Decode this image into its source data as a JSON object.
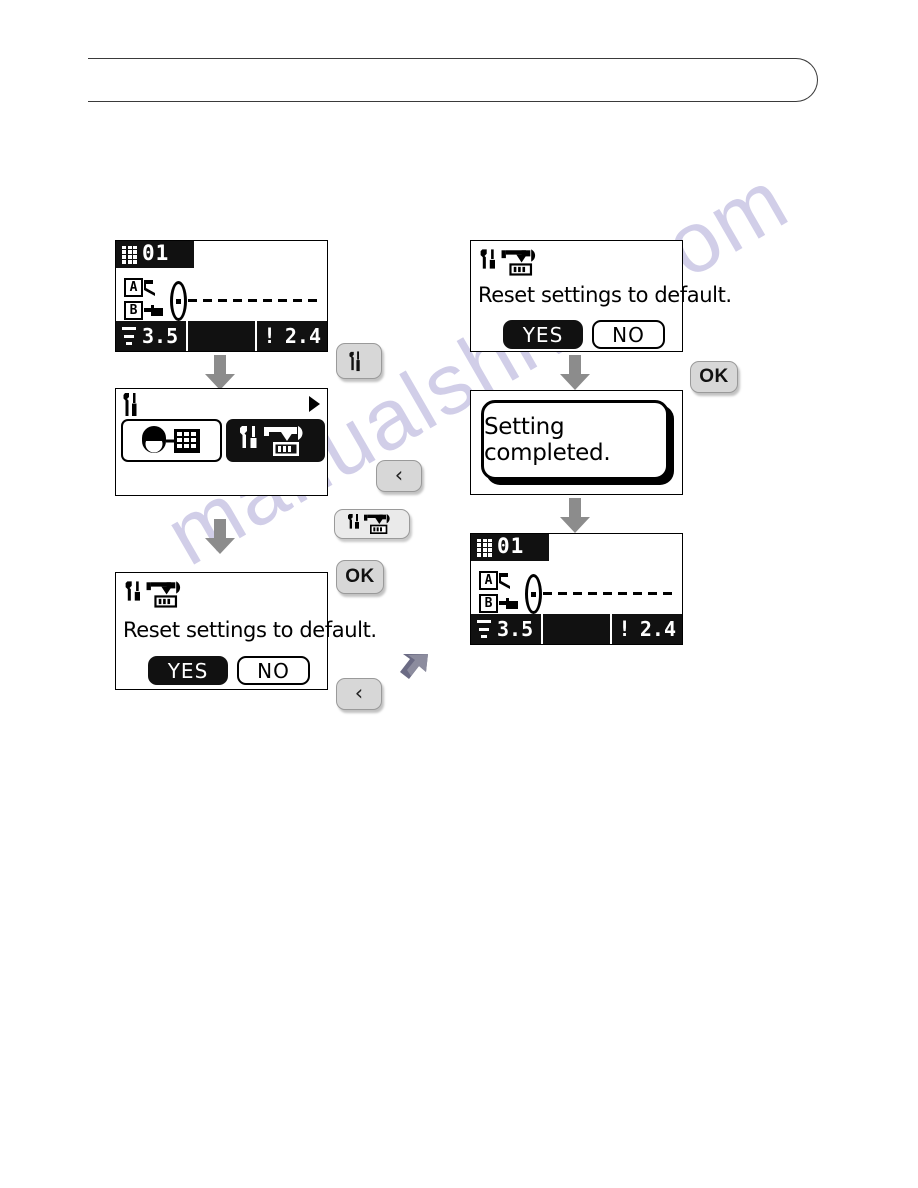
{
  "document": {
    "watermark": "manualshive.com"
  },
  "screens": {
    "stitch_initial": {
      "name": "stitch-select-screen",
      "pattern_number": "01",
      "pattern_grid_icon": "dot-matrix-icon",
      "foot_a_label": "A",
      "foot_b_label": "B",
      "width_icon": "stitch-width-icon",
      "width_value": "3.5",
      "length_icon": "stitch-length-icon",
      "length_value": "2.4",
      "middle_value": ""
    },
    "settings_menu": {
      "name": "settings-menu-screen",
      "header_icon": "tools-icon",
      "next_page_icon": "caret-right-icon",
      "option_machine_settings_icon": "face-grid-icon",
      "option_reset_icon": "tools-reset-icon",
      "selected_option": "reset"
    },
    "confirm_left": {
      "name": "reset-confirm-dialog",
      "icon": "tools-reset-icon",
      "message": "Reset settings to default.",
      "yes_label": "YES",
      "no_label": "NO",
      "selected": "YES"
    },
    "confirm_right": {
      "name": "reset-confirm-dialog",
      "icon": "tools-reset-icon",
      "message": "Reset settings to default.",
      "yes_label": "YES",
      "no_label": "NO",
      "selected": "YES"
    },
    "completed": {
      "name": "setting-completed-dialog",
      "message": "Setting completed."
    },
    "stitch_final": {
      "name": "stitch-select-screen",
      "pattern_number": "01",
      "pattern_grid_icon": "dot-matrix-icon",
      "foot_a_label": "A",
      "foot_b_label": "B",
      "width_icon": "stitch-width-icon",
      "width_value": "3.5",
      "length_icon": "stitch-length-icon",
      "length_value": "2.4",
      "middle_value": ""
    }
  },
  "keys": {
    "settings_key": {
      "name": "settings-key",
      "icon": "tools-icon",
      "label": ""
    },
    "back_key_upper": {
      "name": "back-key",
      "icon": "chevron-left-icon",
      "label": "‹"
    },
    "back_key_lower": {
      "name": "back-key",
      "icon": "chevron-left-icon",
      "label": "‹"
    },
    "ok_key_left": {
      "name": "ok-key",
      "label": "OK"
    },
    "ok_key_right": {
      "name": "ok-key",
      "label": "OK"
    },
    "reset_badge": {
      "name": "reset-function-badge",
      "icon": "tools-reset-icon"
    }
  },
  "flow": {
    "arrow_1": "arrow-down-icon",
    "arrow_2": "arrow-down-icon",
    "arrow_3": "arrow-down-icon",
    "arrow_4": "arrow-down-icon",
    "arrow_diagonal": "arrow-up-right-icon"
  }
}
